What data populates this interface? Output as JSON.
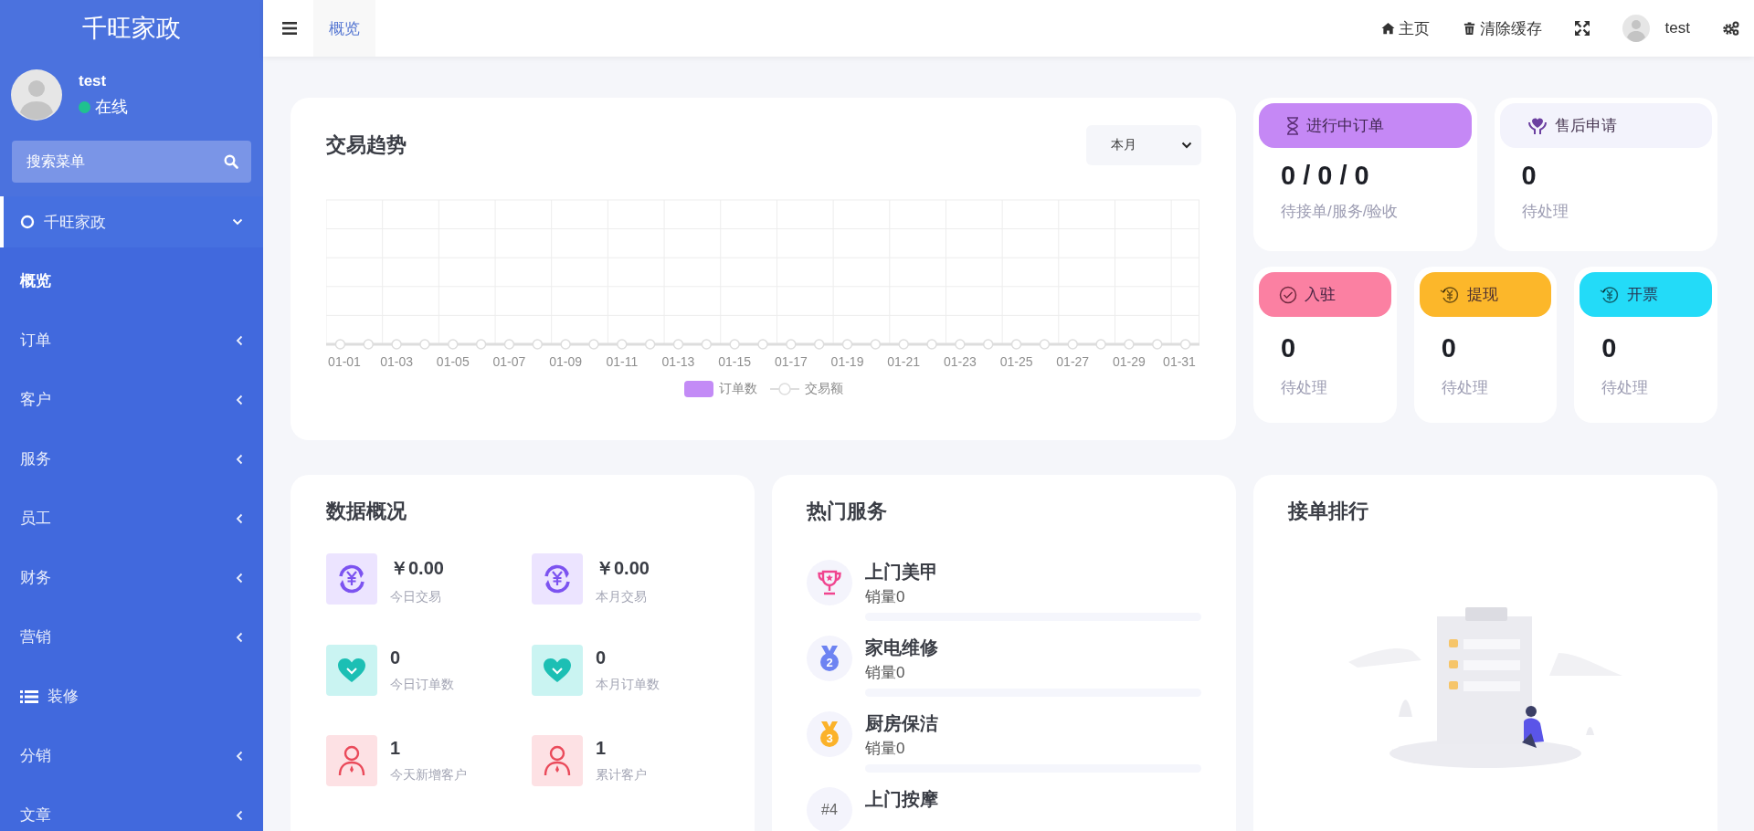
{
  "sidebar": {
    "logo": "千旺家政",
    "user": {
      "name": "test",
      "status": "在线",
      "online": true
    },
    "search": {
      "placeholder": "搜索菜单"
    },
    "menu": [
      {
        "label": "千旺家政",
        "kind": "group",
        "expanded": true,
        "selected": false
      },
      {
        "label": "概览",
        "kind": "page",
        "selected": true
      },
      {
        "label": "订单",
        "kind": "submenu",
        "expanded": false,
        "selected": false
      },
      {
        "label": "客户",
        "kind": "submenu",
        "expanded": false,
        "selected": false
      },
      {
        "label": "服务",
        "kind": "submenu",
        "expanded": false,
        "selected": false
      },
      {
        "label": "员工",
        "kind": "submenu",
        "expanded": false,
        "selected": false
      },
      {
        "label": "财务",
        "kind": "submenu",
        "expanded": false,
        "selected": false
      },
      {
        "label": "营销",
        "kind": "submenu",
        "expanded": false,
        "selected": false
      },
      {
        "label": "装修",
        "kind": "list-page",
        "selected": false
      },
      {
        "label": "分销",
        "kind": "submenu",
        "expanded": false,
        "selected": false
      },
      {
        "label": "文章",
        "kind": "submenu",
        "expanded": false,
        "selected": false
      }
    ]
  },
  "topbar": {
    "tabs": [
      {
        "label": "概览",
        "selected": true
      }
    ],
    "links": [
      {
        "label": "主页",
        "kind": "home"
      },
      {
        "label": "清除缓存",
        "kind": "trash"
      }
    ],
    "user": "test"
  },
  "trend": {
    "title": "交易趋势",
    "period": "本月",
    "x_labels": [
      "01-01",
      "01-03",
      "01-05",
      "01-07",
      "01-09",
      "01-11",
      "01-13",
      "01-15",
      "01-17",
      "01-19",
      "01-21",
      "01-23",
      "01-25",
      "01-27",
      "01-29",
      "01-31"
    ],
    "legend": [
      {
        "label": "订单数",
        "kind": "bar",
        "color": "#c38bf6"
      },
      {
        "label": "交易额",
        "kind": "line",
        "color": "#dddddd"
      }
    ]
  },
  "status_cards": [
    {
      "title": "进行中订单",
      "kind": "hourglass",
      "color": "#c588f5",
      "value": "0 / 0 / 0",
      "caption": "待接单/服务/验收"
    },
    {
      "title": "售后申请",
      "kind": "care",
      "color": "#f3f3fc",
      "value": "0",
      "caption": "待处理"
    },
    {
      "title": "入驻",
      "kind": "check",
      "color": "#fb80a2",
      "value": "0",
      "caption": "待处理"
    },
    {
      "title": "提现",
      "kind": "yen",
      "color": "#fcb72a",
      "value": "0",
      "caption": "待处理"
    },
    {
      "title": "开票",
      "kind": "yen",
      "color": "#23dbf8",
      "value": "0",
      "caption": "待处理"
    }
  ],
  "overview": {
    "title": "数据概况",
    "items": [
      {
        "kind": "money",
        "value": "￥0.00",
        "label": "今日交易"
      },
      {
        "kind": "money",
        "value": "￥0.00",
        "label": "本月交易"
      },
      {
        "kind": "orders",
        "value": "0",
        "label": "今日订单数"
      },
      {
        "kind": "orders",
        "value": "0",
        "label": "本月订单数"
      },
      {
        "kind": "customers",
        "value": "1",
        "label": "今天新增客户"
      },
      {
        "kind": "customers",
        "value": "1",
        "label": "累计客户"
      }
    ]
  },
  "hot_services": {
    "title": "热门服务",
    "items": [
      {
        "kind": "trophy",
        "color": "#f0458f",
        "name": "上门美甲",
        "sales": "销量0",
        "level": 0
      },
      {
        "kind": "medal",
        "color": "#6d83f2",
        "rank": "2",
        "name": "家电维修",
        "sales": "销量0",
        "level": 0
      },
      {
        "kind": "medal",
        "color": "#fbb22a",
        "rank": "3",
        "name": "厨房保洁",
        "sales": "销量0",
        "level": 0
      },
      {
        "kind": "plain",
        "color": "#666666",
        "rank": "#4",
        "name": "上门按摩"
      }
    ]
  },
  "ranking": {
    "title": "接单排行"
  }
}
